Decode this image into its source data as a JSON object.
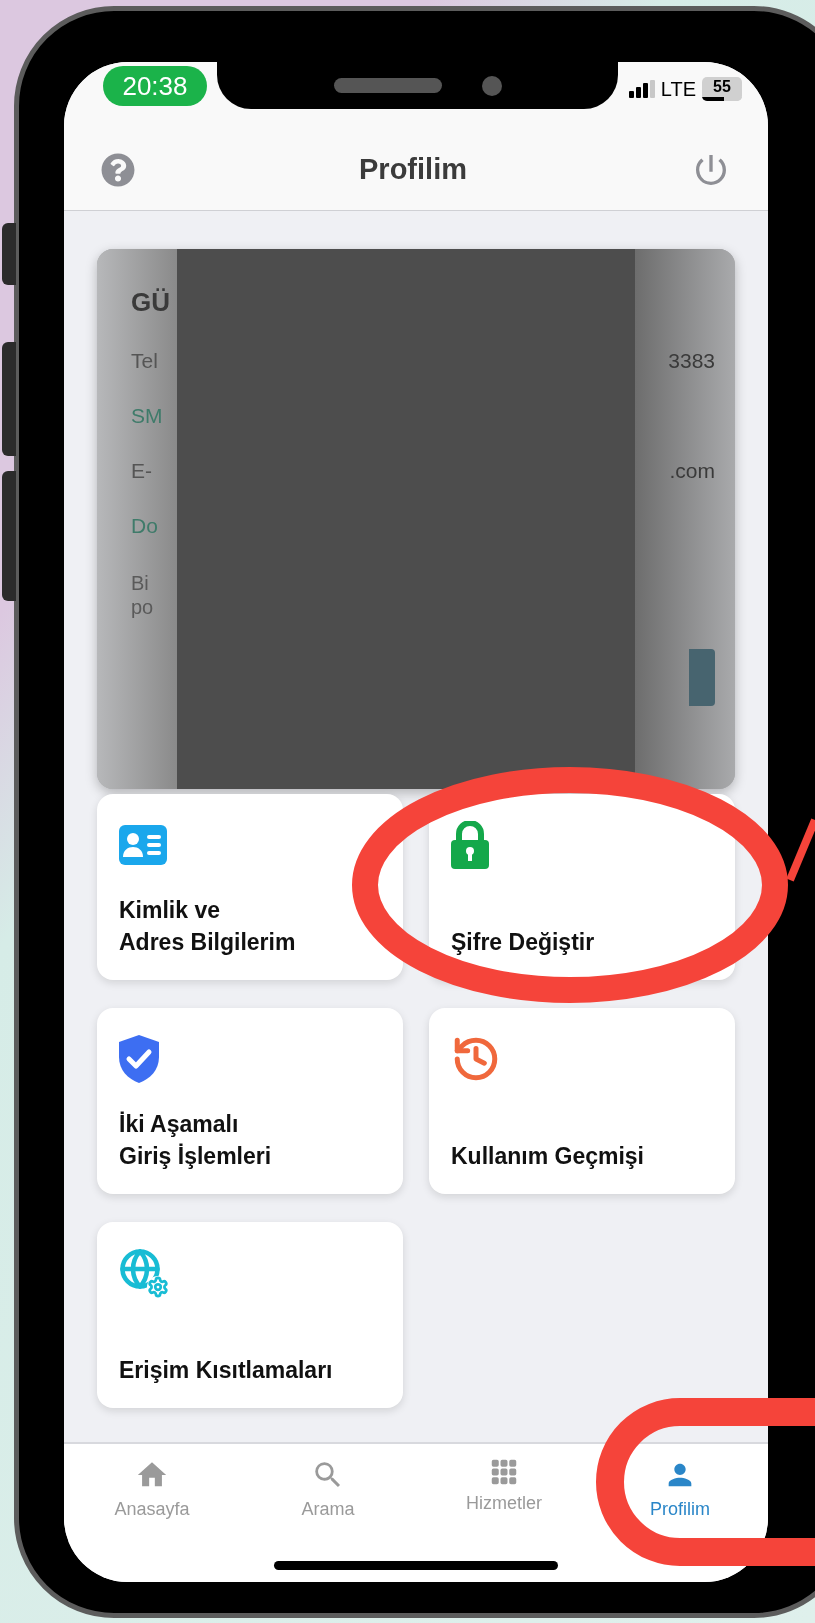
{
  "status_bar": {
    "time": "20:38",
    "network": "LTE",
    "battery": {
      "label": "55",
      "level": 0.55
    }
  },
  "header": {
    "title": "Profilim"
  },
  "profile_card": {
    "name": "GÜ",
    "rows": [
      {
        "kind": "field",
        "label": "Tel",
        "value": "3383"
      },
      {
        "kind": "link",
        "label": "SM"
      },
      {
        "kind": "field",
        "label": "E-",
        "value": ".com"
      },
      {
        "kind": "link",
        "label": "Do"
      }
    ],
    "note_lines": [
      "Bi",
      "po"
    ]
  },
  "menu": [
    {
      "kind": "idcard",
      "lines": [
        "Kimlik ve",
        "Adres Bilgilerim"
      ]
    },
    {
      "kind": "padlock",
      "lines": [
        "Şifre Değiştir"
      ]
    },
    {
      "kind": "shield",
      "lines": [
        "İki Aşamalı",
        "Giriş İşlemleri"
      ]
    },
    {
      "kind": "history",
      "lines": [
        "Kullanım Geçmişi"
      ]
    },
    {
      "kind": "globe",
      "lines": [
        "Erişim Kısıtlamaları"
      ]
    }
  ],
  "tabs": [
    {
      "kind": "home",
      "label": "Anasayfa",
      "selected": false
    },
    {
      "kind": "search",
      "label": "Arama",
      "selected": false
    },
    {
      "kind": "grid",
      "label": "Hizmetler",
      "selected": false
    },
    {
      "kind": "person",
      "label": "Profilim",
      "selected": true
    }
  ]
}
